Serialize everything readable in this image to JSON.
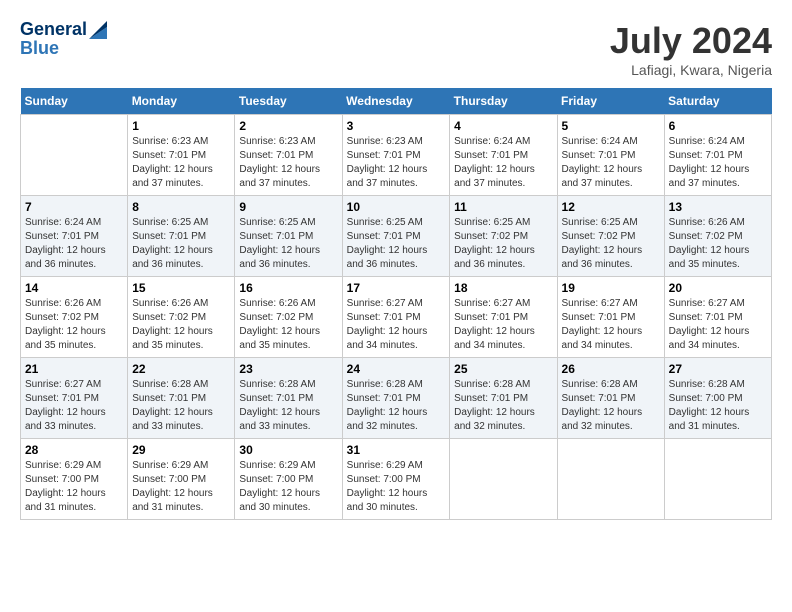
{
  "header": {
    "logo_line1": "General",
    "logo_line2": "Blue",
    "title": "July 2024",
    "subtitle": "Lafiagi, Kwara, Nigeria"
  },
  "calendar": {
    "days_of_week": [
      "Sunday",
      "Monday",
      "Tuesday",
      "Wednesday",
      "Thursday",
      "Friday",
      "Saturday"
    ],
    "weeks": [
      [
        {
          "day": "",
          "info": ""
        },
        {
          "day": "1",
          "info": "Sunrise: 6:23 AM\nSunset: 7:01 PM\nDaylight: 12 hours\nand 37 minutes."
        },
        {
          "day": "2",
          "info": "Sunrise: 6:23 AM\nSunset: 7:01 PM\nDaylight: 12 hours\nand 37 minutes."
        },
        {
          "day": "3",
          "info": "Sunrise: 6:23 AM\nSunset: 7:01 PM\nDaylight: 12 hours\nand 37 minutes."
        },
        {
          "day": "4",
          "info": "Sunrise: 6:24 AM\nSunset: 7:01 PM\nDaylight: 12 hours\nand 37 minutes."
        },
        {
          "day": "5",
          "info": "Sunrise: 6:24 AM\nSunset: 7:01 PM\nDaylight: 12 hours\nand 37 minutes."
        },
        {
          "day": "6",
          "info": "Sunrise: 6:24 AM\nSunset: 7:01 PM\nDaylight: 12 hours\nand 37 minutes."
        }
      ],
      [
        {
          "day": "7",
          "info": "Sunrise: 6:24 AM\nSunset: 7:01 PM\nDaylight: 12 hours\nand 36 minutes."
        },
        {
          "day": "8",
          "info": "Sunrise: 6:25 AM\nSunset: 7:01 PM\nDaylight: 12 hours\nand 36 minutes."
        },
        {
          "day": "9",
          "info": "Sunrise: 6:25 AM\nSunset: 7:01 PM\nDaylight: 12 hours\nand 36 minutes."
        },
        {
          "day": "10",
          "info": "Sunrise: 6:25 AM\nSunset: 7:01 PM\nDaylight: 12 hours\nand 36 minutes."
        },
        {
          "day": "11",
          "info": "Sunrise: 6:25 AM\nSunset: 7:02 PM\nDaylight: 12 hours\nand 36 minutes."
        },
        {
          "day": "12",
          "info": "Sunrise: 6:25 AM\nSunset: 7:02 PM\nDaylight: 12 hours\nand 36 minutes."
        },
        {
          "day": "13",
          "info": "Sunrise: 6:26 AM\nSunset: 7:02 PM\nDaylight: 12 hours\nand 35 minutes."
        }
      ],
      [
        {
          "day": "14",
          "info": "Sunrise: 6:26 AM\nSunset: 7:02 PM\nDaylight: 12 hours\nand 35 minutes."
        },
        {
          "day": "15",
          "info": "Sunrise: 6:26 AM\nSunset: 7:02 PM\nDaylight: 12 hours\nand 35 minutes."
        },
        {
          "day": "16",
          "info": "Sunrise: 6:26 AM\nSunset: 7:02 PM\nDaylight: 12 hours\nand 35 minutes."
        },
        {
          "day": "17",
          "info": "Sunrise: 6:27 AM\nSunset: 7:01 PM\nDaylight: 12 hours\nand 34 minutes."
        },
        {
          "day": "18",
          "info": "Sunrise: 6:27 AM\nSunset: 7:01 PM\nDaylight: 12 hours\nand 34 minutes."
        },
        {
          "day": "19",
          "info": "Sunrise: 6:27 AM\nSunset: 7:01 PM\nDaylight: 12 hours\nand 34 minutes."
        },
        {
          "day": "20",
          "info": "Sunrise: 6:27 AM\nSunset: 7:01 PM\nDaylight: 12 hours\nand 34 minutes."
        }
      ],
      [
        {
          "day": "21",
          "info": "Sunrise: 6:27 AM\nSunset: 7:01 PM\nDaylight: 12 hours\nand 33 minutes."
        },
        {
          "day": "22",
          "info": "Sunrise: 6:28 AM\nSunset: 7:01 PM\nDaylight: 12 hours\nand 33 minutes."
        },
        {
          "day": "23",
          "info": "Sunrise: 6:28 AM\nSunset: 7:01 PM\nDaylight: 12 hours\nand 33 minutes."
        },
        {
          "day": "24",
          "info": "Sunrise: 6:28 AM\nSunset: 7:01 PM\nDaylight: 12 hours\nand 32 minutes."
        },
        {
          "day": "25",
          "info": "Sunrise: 6:28 AM\nSunset: 7:01 PM\nDaylight: 12 hours\nand 32 minutes."
        },
        {
          "day": "26",
          "info": "Sunrise: 6:28 AM\nSunset: 7:01 PM\nDaylight: 12 hours\nand 32 minutes."
        },
        {
          "day": "27",
          "info": "Sunrise: 6:28 AM\nSunset: 7:00 PM\nDaylight: 12 hours\nand 31 minutes."
        }
      ],
      [
        {
          "day": "28",
          "info": "Sunrise: 6:29 AM\nSunset: 7:00 PM\nDaylight: 12 hours\nand 31 minutes."
        },
        {
          "day": "29",
          "info": "Sunrise: 6:29 AM\nSunset: 7:00 PM\nDaylight: 12 hours\nand 31 minutes."
        },
        {
          "day": "30",
          "info": "Sunrise: 6:29 AM\nSunset: 7:00 PM\nDaylight: 12 hours\nand 30 minutes."
        },
        {
          "day": "31",
          "info": "Sunrise: 6:29 AM\nSunset: 7:00 PM\nDaylight: 12 hours\nand 30 minutes."
        },
        {
          "day": "",
          "info": ""
        },
        {
          "day": "",
          "info": ""
        },
        {
          "day": "",
          "info": ""
        }
      ]
    ]
  }
}
